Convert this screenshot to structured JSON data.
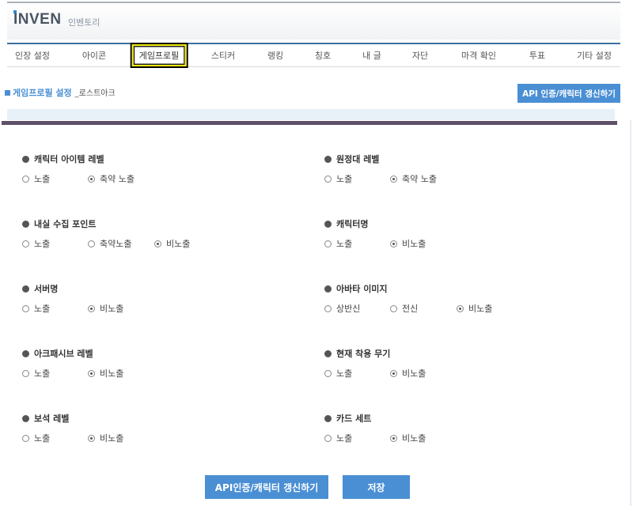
{
  "header": {
    "logo_text": "INVEN",
    "logo_sub": "인벤토리"
  },
  "nav": [
    {
      "label": "인장 설정"
    },
    {
      "label": "아이콘"
    },
    {
      "label": "게임프로필",
      "active": true
    },
    {
      "label": "스티커"
    },
    {
      "label": "랭킹"
    },
    {
      "label": "칭호"
    },
    {
      "label": "내 글"
    },
    {
      "label": "자단"
    },
    {
      "label": "마격 확인"
    },
    {
      "label": "투표"
    },
    {
      "label": "기타 설정"
    }
  ],
  "section": {
    "title": "게임프로필 설정",
    "subtitle": "_로스트아크",
    "api_button": "API 인증/캐릭터 갱신하기"
  },
  "fields": [
    {
      "label": "캐릭터 아이템 레벨",
      "options": [
        "노출",
        "축약 노출"
      ],
      "selected": 1
    },
    {
      "label": "원정대 레벨",
      "options": [
        "노출",
        "축약 노출"
      ],
      "selected": 1
    },
    {
      "label": "내실 수집 포인트",
      "options": [
        "노출",
        "축약노출",
        "비노출"
      ],
      "selected": 2
    },
    {
      "label": "캐릭터명",
      "options": [
        "노출",
        "비노출"
      ],
      "selected": 1
    },
    {
      "label": "서버명",
      "options": [
        "노출",
        "비노출"
      ],
      "selected": 1
    },
    {
      "label": "아바타 이미지",
      "options": [
        "상반신",
        "전신",
        "비노출"
      ],
      "selected": 2
    },
    {
      "label": "아크패시브 레벨",
      "options": [
        "노출",
        "비노출"
      ],
      "selected": 1
    },
    {
      "label": "현재 착용 무기",
      "options": [
        "노출",
        "비노출"
      ],
      "selected": 1
    },
    {
      "label": "보석 레벨",
      "options": [
        "노출",
        "비노출"
      ],
      "selected": 1
    },
    {
      "label": "카드 세트",
      "options": [
        "노출",
        "비노출"
      ],
      "selected": 1
    }
  ],
  "buttons": {
    "api_refresh": "API인증/캐릭터 갱신하기",
    "save": "저장"
  },
  "colors": {
    "accent": "#4a8fd4",
    "nav_border": "#3d6f9e",
    "divider_dark": "#5e5068",
    "highlight_box": "#f1ea13"
  }
}
